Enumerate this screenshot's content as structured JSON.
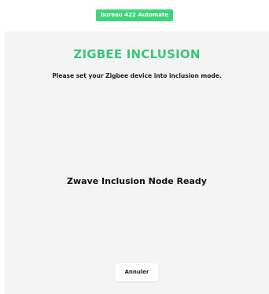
{
  "header": {
    "badge_label": "bureau 422 Automate",
    "badge_color": "#3ed479"
  },
  "dialog": {
    "title": "ZIGBEE INCLUSION",
    "title_color": "#3ec47a",
    "instruction": "Please set your Zigbee device into inclusion mode.",
    "status": "Zwave Inclusion Node Ready",
    "cancel_label": "Annuler"
  }
}
